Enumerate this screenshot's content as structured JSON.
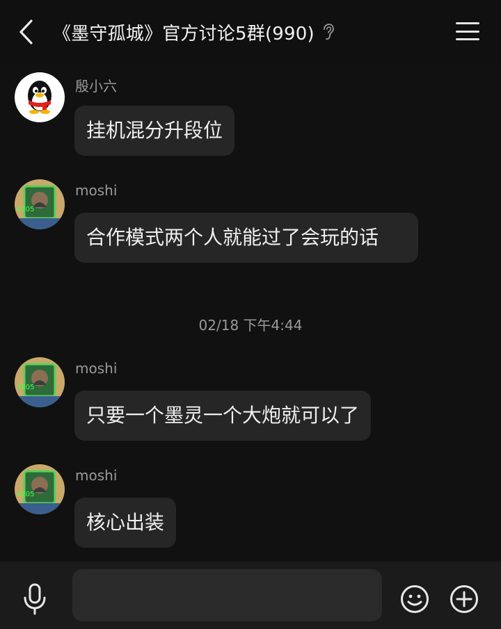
{
  "header": {
    "title": "《墨守孤城》官方讨论5群(990)",
    "back_icon": "chevron-left-icon",
    "ear_icon": "ear-icon",
    "menu_icon": "hamburger-menu-icon"
  },
  "messages": [
    {
      "sender": "殷小六",
      "text": "挂机混分升段位",
      "avatar": "qq-penguin-avatar"
    },
    {
      "sender": "moshi",
      "text": "合作模式两个人就能过了会玩的话",
      "avatar": "game-avatar"
    },
    {
      "sender": "moshi",
      "text": "只要一个墨灵一个大炮就可以了",
      "avatar": "game-avatar"
    },
    {
      "sender": "moshi",
      "text": "核心出装",
      "avatar": "game-avatar"
    }
  ],
  "timestamp": "02/18 下午4:44",
  "input_bar": {
    "placeholder": "",
    "mic_icon": "microphone-icon",
    "emoji_icon": "emoji-icon",
    "plus_icon": "plus-circle-icon"
  },
  "colors": {
    "background": "#111111",
    "header_bg": "#101010",
    "bubble_bg": "#262626",
    "input_bar_bg": "#1b1b1b",
    "secondary_text": "#9a9a9a"
  }
}
